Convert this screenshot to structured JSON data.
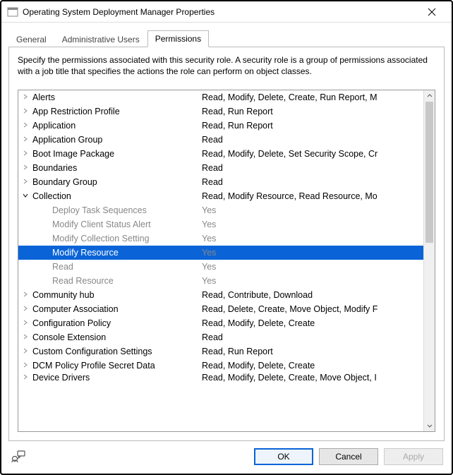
{
  "titlebar": {
    "title": "Operating System Deployment Manager Properties"
  },
  "tabs": [
    {
      "label": "General"
    },
    {
      "label": "Administrative Users"
    },
    {
      "label": "Permissions"
    }
  ],
  "activeTabIndex": 2,
  "panel": {
    "description": "Specify the permissions associated with this security role. A security role is a group of permissions associated with a job title that specifies the actions the role can perform on object classes."
  },
  "tree": [
    {
      "type": "group",
      "expanded": false,
      "label": "Alerts",
      "value": "Read, Modify, Delete, Create, Run Report, M"
    },
    {
      "type": "group",
      "expanded": false,
      "label": "App Restriction Profile",
      "value": "Read, Run Report"
    },
    {
      "type": "group",
      "expanded": false,
      "label": "Application",
      "value": "Read, Run Report"
    },
    {
      "type": "group",
      "expanded": false,
      "label": "Application Group",
      "value": "Read"
    },
    {
      "type": "group",
      "expanded": false,
      "label": "Boot Image Package",
      "value": "Read, Modify, Delete, Set Security Scope, Cr"
    },
    {
      "type": "group",
      "expanded": false,
      "label": "Boundaries",
      "value": "Read"
    },
    {
      "type": "group",
      "expanded": false,
      "label": "Boundary Group",
      "value": "Read"
    },
    {
      "type": "group",
      "expanded": true,
      "label": "Collection",
      "value": "Read, Modify Resource, Read Resource, Mo"
    },
    {
      "type": "child",
      "label": "Deploy Task Sequences",
      "value": "Yes"
    },
    {
      "type": "child",
      "label": "Modify Client Status Alert",
      "value": "Yes"
    },
    {
      "type": "child",
      "label": "Modify Collection Setting",
      "value": "Yes"
    },
    {
      "type": "child",
      "selected": true,
      "label": "Modify Resource",
      "value": "Yes"
    },
    {
      "type": "child",
      "label": "Read",
      "value": "Yes"
    },
    {
      "type": "child",
      "label": "Read Resource",
      "value": "Yes"
    },
    {
      "type": "group",
      "expanded": false,
      "label": "Community hub",
      "value": "Read, Contribute, Download"
    },
    {
      "type": "group",
      "expanded": false,
      "label": "Computer Association",
      "value": "Read, Delete, Create, Move Object, Modify F"
    },
    {
      "type": "group",
      "expanded": false,
      "label": "Configuration Policy",
      "value": "Read, Modify, Delete, Create"
    },
    {
      "type": "group",
      "expanded": false,
      "label": "Console Extension",
      "value": "Read"
    },
    {
      "type": "group",
      "expanded": false,
      "label": "Custom Configuration Settings",
      "value": "Read, Run Report"
    },
    {
      "type": "group",
      "expanded": false,
      "label": "DCM Policy Profile Secret Data",
      "value": "Read, Modify, Delete, Create"
    },
    {
      "type": "group",
      "expanded": false,
      "cutoff": true,
      "label": "Device Drivers",
      "value": "Read, Modify, Delete, Create, Move Object, I"
    }
  ],
  "buttons": {
    "ok": "OK",
    "cancel": "Cancel",
    "apply": "Apply"
  }
}
